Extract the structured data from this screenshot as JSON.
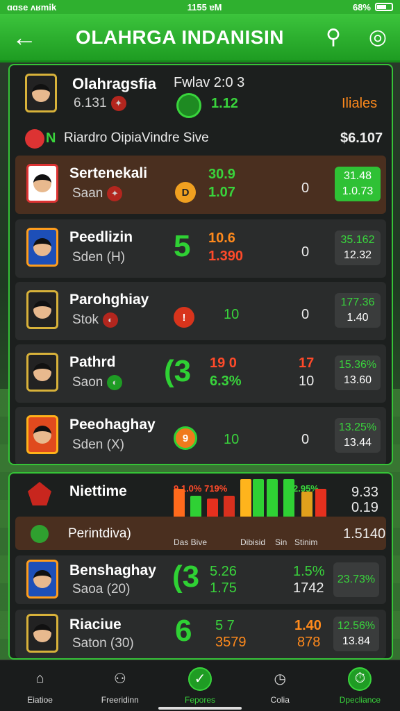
{
  "status": {
    "left": "ɑɑse ʌʁmik",
    "time": "1155 ɐM",
    "battery": "68%"
  },
  "header": {
    "title": "OLAHRGA INDANISIN"
  },
  "summary": {
    "team_name": "Olahragsfia",
    "team_sub": "6.131",
    "fixture": "Fwlav 2:0 3",
    "score": "1.12",
    "tag": "Iliales",
    "info_line": "Riardro OipiaVindre Sive",
    "info_value": "$6.107",
    "info_badge": "N"
  },
  "rows": [
    {
      "name": "Sertenekali",
      "sub": "Saan",
      "a": "30.9",
      "b": "1.07",
      "mid": "0",
      "box_top": "31.48",
      "box_bot": "1.0.73"
    },
    {
      "name": "Peedlizin",
      "sub": "Sden (H)",
      "a": "10.6",
      "b": "1.390",
      "mid": "0",
      "box_top": "35.162",
      "box_bot": "12.32",
      "sym": "5"
    },
    {
      "name": "Parohghiay",
      "sub": "Stok",
      "a": "",
      "b": "10",
      "mid": "0",
      "box_top": "177.36",
      "box_bot": "1.40"
    },
    {
      "name": "Pathrd",
      "sub": "Saon",
      "a": "19 0",
      "b": "6.3%",
      "mid_a": "17",
      "mid": "10",
      "box_top": "15.36%",
      "box_bot": "13.60",
      "sym": "(3"
    },
    {
      "name": "Peeohaghay",
      "sub": "Sden (X)",
      "a": "",
      "b": "10",
      "mid": "0",
      "box_top": "13.25%",
      "box_bot": "13.44"
    }
  ],
  "bottom": {
    "chart_name": "Niettime",
    "chart_val_top": "9.33",
    "chart_val_bot": "0.19",
    "chart_nums": "9 1.0% 719%",
    "chart_nums2": "2.95%",
    "bar_labels": [
      "Das Bive",
      "Dibisid",
      "Sin",
      "Stinim"
    ],
    "hl_name": "Perintdiva)",
    "hl_value": "1.5140",
    "rows": [
      {
        "name": "Benshaghay",
        "sub": "Saoa (20)",
        "a": "5.26",
        "b": "1.75",
        "c": "1.5%",
        "d": "1742",
        "box": "23.73%",
        "sym": "(3"
      },
      {
        "name": "Riaciue",
        "sub": "Saton (30)",
        "a": "5 7",
        "b": "3579",
        "c": "1.40",
        "d": "878",
        "box_top": "12.56%",
        "box_bot": "13.84",
        "sym": "6"
      }
    ]
  },
  "tabs": [
    "Eiatioe",
    "Freeridinn",
    "Fepores",
    "Colia",
    "Dpecliance"
  ]
}
